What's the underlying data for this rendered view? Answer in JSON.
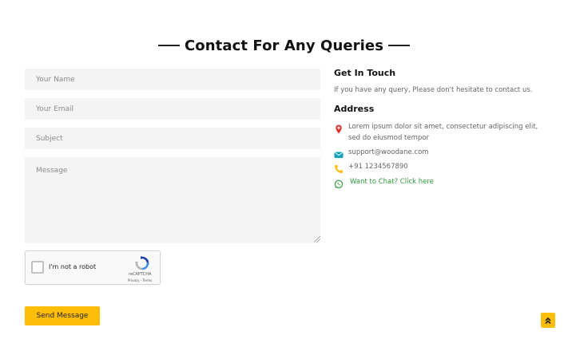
{
  "section": {
    "title": "Contact For Any Queries"
  },
  "form": {
    "name_placeholder": "Your Name",
    "email_placeholder": "Your Email",
    "subject_placeholder": "Subject",
    "message_placeholder": "Message",
    "submit_label": "Send Message"
  },
  "captcha": {
    "label": "I'm not a robot",
    "brand": "reCAPTCHA",
    "links": "Privacy - Terms"
  },
  "contact": {
    "heading": "Get In Touch",
    "intro": "If you have any query, Please don't hesitate to contact us.",
    "address_heading": "Address",
    "address": "Lorem ipsum dolor sit amet, consectetur adipiscing elit, sed do eiusmod tempor",
    "email": "support@woodane.com",
    "phone": "+91 1234567890",
    "chat_label": "Want to Chat? Click here"
  },
  "colors": {
    "accent": "#fdbe09",
    "map_pin": "#e53935",
    "email_icon": "#17a2b8",
    "phone_icon": "#fdbe09",
    "whatsapp": "#2e9a3a"
  },
  "icons": {
    "address": "map-pin-icon",
    "email": "envelope-icon",
    "phone": "phone-icon",
    "chat": "whatsapp-icon",
    "scroll": "double-chevron-up-icon"
  }
}
